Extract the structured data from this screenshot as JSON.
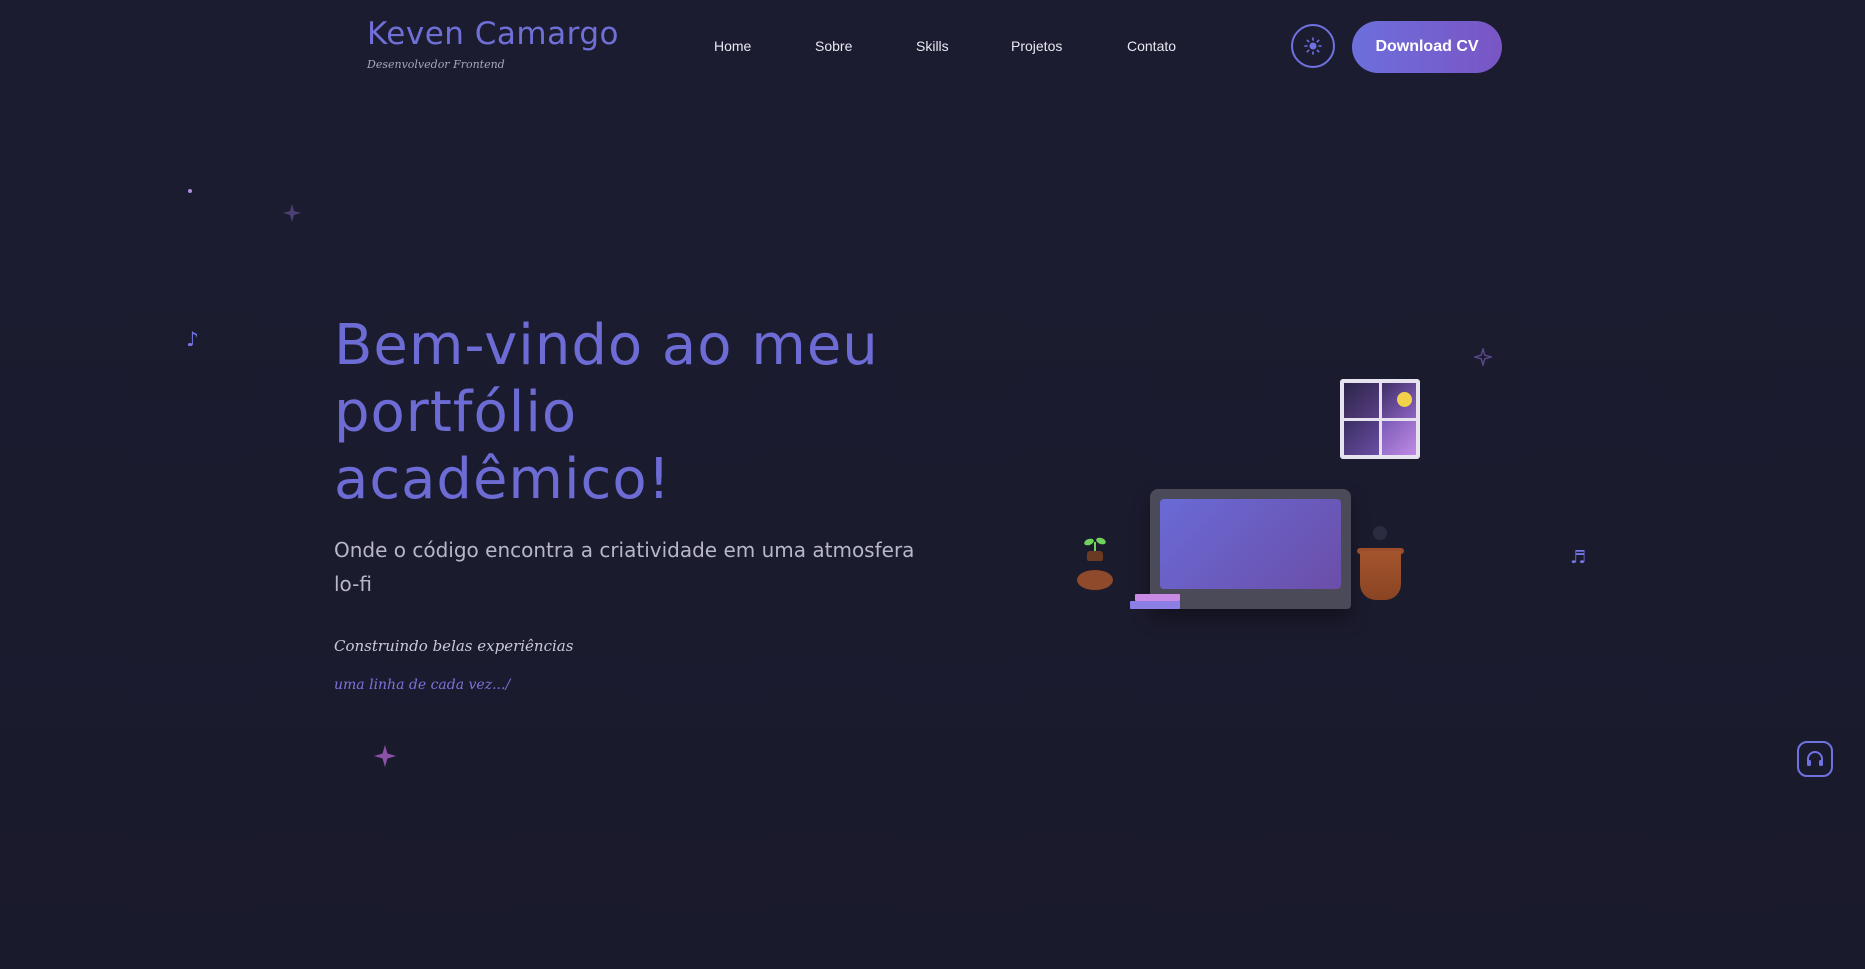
{
  "header": {
    "brand_name": "Keven Camargo",
    "brand_subtitle": "Desenvolvedor Frontend",
    "nav": [
      {
        "label": "Home"
      },
      {
        "label": "Sobre"
      },
      {
        "label": "Skills"
      },
      {
        "label": "Projetos"
      },
      {
        "label": "Contato"
      }
    ],
    "theme_toggle_icon": "sun-icon",
    "cv_button_label": "Download CV"
  },
  "hero": {
    "title": "Bem-vindo ao meu portfólio acadêmico!",
    "subtitle": "Onde o código encontra a criatividade em uma atmosfera lo-fi",
    "tagline_1": "Construindo belas experiências",
    "tagline_2": "uma linha de cada vez.../"
  },
  "decorations": {
    "note_1": "♪",
    "note_2": "♬"
  },
  "audio_button_icon": "headphones-icon",
  "colors": {
    "background": "#1b1b2f",
    "accent": "#6d6bd4",
    "button_gradient_start": "#6c6fdc",
    "button_gradient_end": "#7a55c4",
    "moon": "#f2d24a"
  }
}
